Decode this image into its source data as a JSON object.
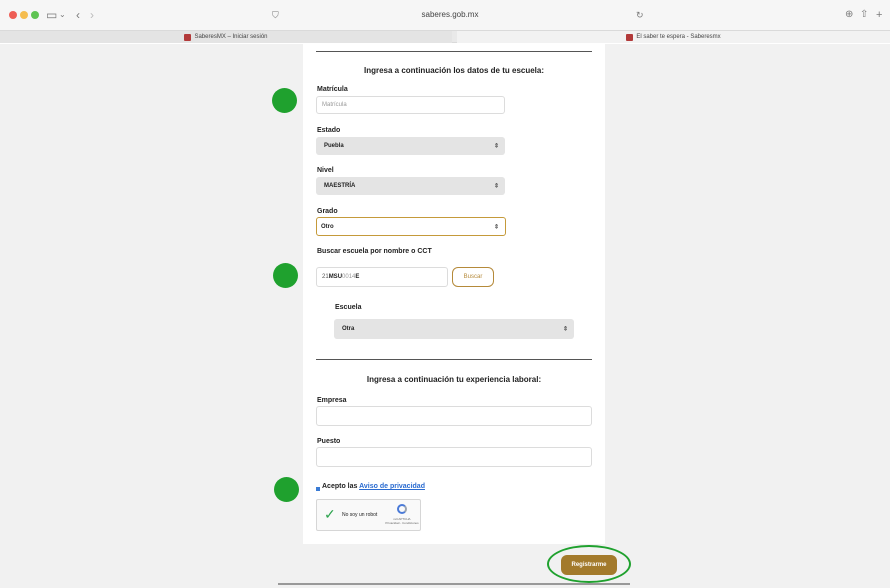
{
  "browser": {
    "url": "saberes.gob.mx",
    "tabs": [
      {
        "label": "SaberesMX – Iniciar sesión"
      },
      {
        "label": "El saber te espera - Saberesmx"
      }
    ]
  },
  "school_section": {
    "title": "Ingresa a continuación los datos de tu escuela:",
    "matricula_label": "Matrícula",
    "matricula_placeholder": "Matrícula",
    "estado_label": "Estado",
    "estado_value": "Puebla",
    "nivel_label": "Nivel",
    "nivel_value": "MAESTRÍA",
    "grado_label": "Grado",
    "grado_value": "Otro",
    "search_label": "Buscar escuela por nombre o CCT",
    "search_value_prefix": "21",
    "search_value_bold": "MSU",
    "search_value_mid": "0014",
    "search_value_suffix": "E",
    "search_button": "Buscar",
    "escuela_label": "Escuela",
    "escuela_value": "Otra"
  },
  "work_section": {
    "title": "Ingresa a continuación tu experiencia laboral:",
    "empresa_label": "Empresa",
    "puesto_label": "Puesto"
  },
  "privacy": {
    "prefix": "Acepto las ",
    "link": "Aviso de privacidad"
  },
  "captcha": {
    "text": "No soy un robot",
    "brand": "reCAPTCHA",
    "links": "Privacidad - Condiciones"
  },
  "submit_label": "Registrarme",
  "colors": {
    "accent": "#a37a2c",
    "annotation": "#1fa12e"
  }
}
